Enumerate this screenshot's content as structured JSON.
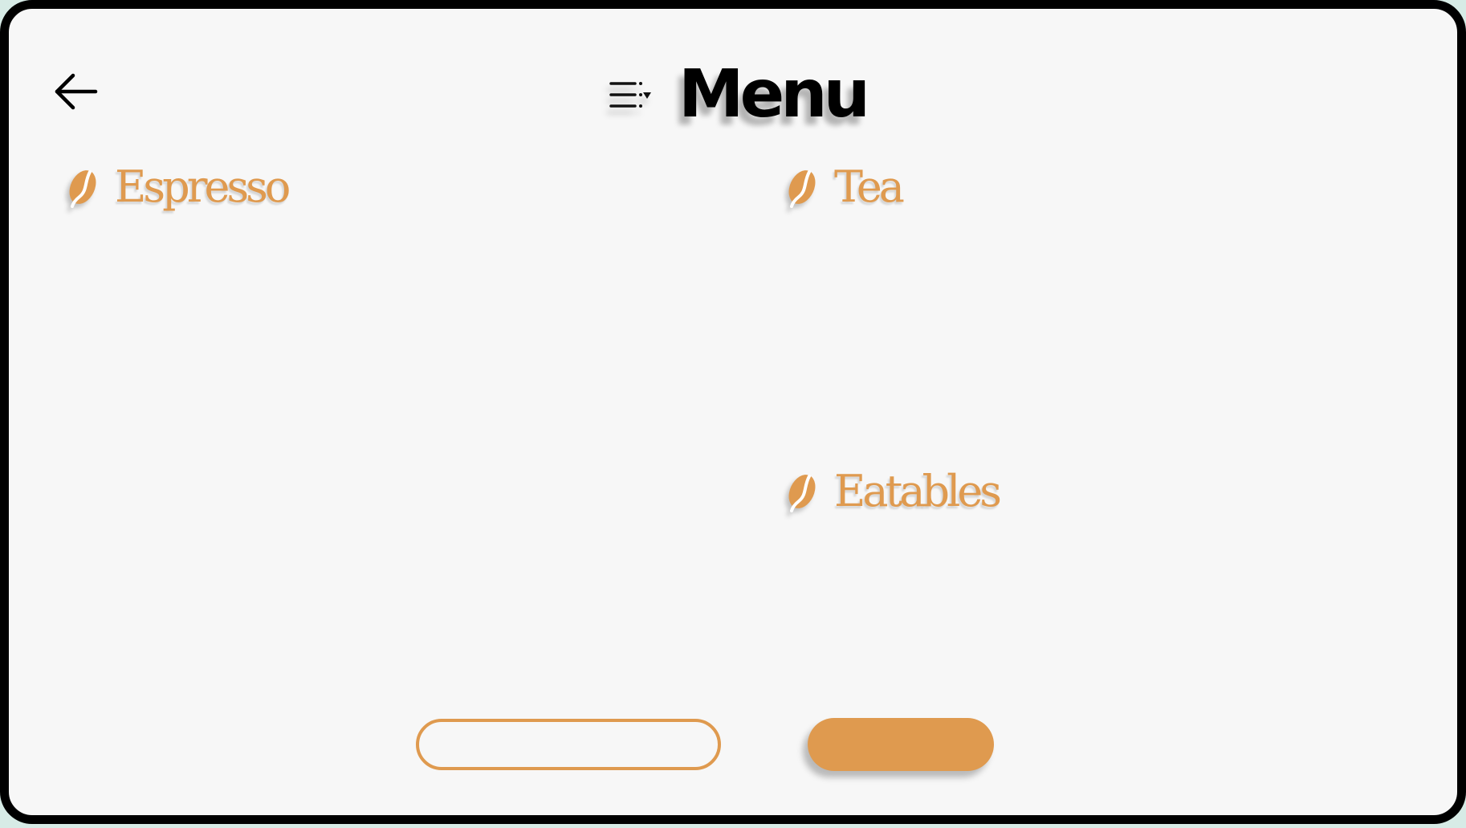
{
  "header": {
    "title": "Menu",
    "back_icon": "arrow-left-icon",
    "filter_icon": "list-filter-icon"
  },
  "categories": [
    {
      "label": "Espresso",
      "icon": "coffee-bean-icon"
    },
    {
      "label": "Tea",
      "icon": "coffee-bean-icon"
    },
    {
      "label": "Eatables",
      "icon": "coffee-bean-icon"
    }
  ],
  "footer": {
    "secondary_button_label": "",
    "primary_button_label": ""
  },
  "colors": {
    "accent": "#df9a4f",
    "background": "#f7f7f7",
    "frame": "#000000",
    "text": "#000000"
  }
}
